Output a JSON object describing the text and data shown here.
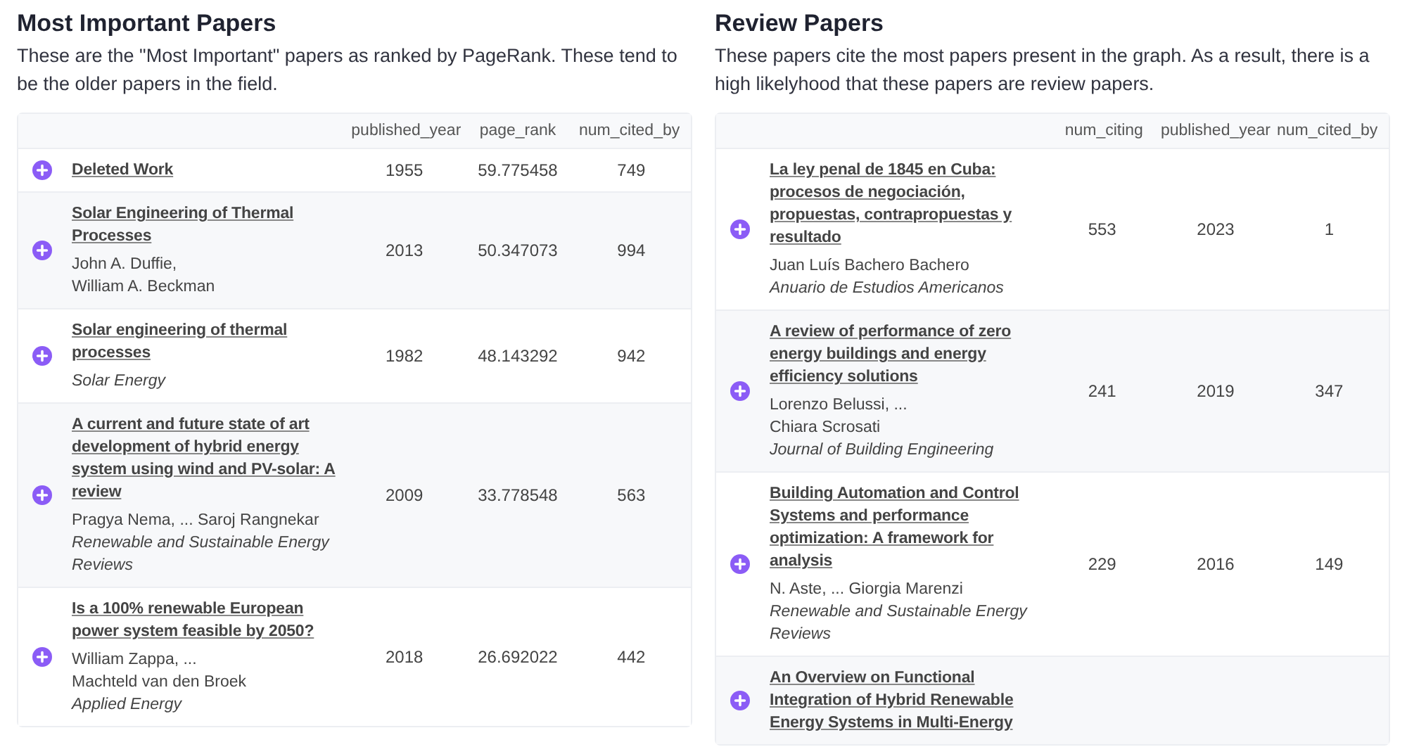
{
  "panels": [
    {
      "title": "Most Important Papers",
      "description": "These are the \"Most Important\" papers as ranked by PageRank. These tend to be the older papers in the field.",
      "columns": [
        "published_year",
        "page_rank",
        "num_cited_by"
      ],
      "rows": [
        {
          "title": "Deleted Work",
          "authors": [],
          "journal": "",
          "values": [
            "1955",
            "59.775458",
            "749"
          ]
        },
        {
          "title": "Solar Engineering of Thermal Processes",
          "authors": [
            "John A. Duffie,",
            "William A. Beckman"
          ],
          "journal": "",
          "values": [
            "2013",
            "50.347073",
            "994"
          ]
        },
        {
          "title": "Solar engineering of thermal processes",
          "authors": [],
          "journal": "Solar Energy",
          "values": [
            "1982",
            "48.143292",
            "942"
          ]
        },
        {
          "title": "A current and future state of art development of hybrid energy system using wind and PV-solar: A review",
          "authors": [
            "Pragya Nema, ... Saroj Rangnekar"
          ],
          "journal": "Renewable and Sustainable Energy Reviews",
          "values": [
            "2009",
            "33.778548",
            "563"
          ]
        },
        {
          "title": "Is a 100% renewable European power system feasible by 2050?",
          "authors": [
            "William Zappa, ...",
            "Machteld van den Broek"
          ],
          "journal": "Applied Energy",
          "values": [
            "2018",
            "26.692022",
            "442"
          ]
        }
      ]
    },
    {
      "title": "Review Papers",
      "description": "These papers cite the most papers present in the graph. As a result, there is a high likelyhood that these papers are review papers.",
      "columns": [
        "num_citing",
        "published_year",
        "num_cited_by"
      ],
      "rows": [
        {
          "title": "La ley penal de 1845 en Cuba: procesos de negociación, propuestas, contrapropuestas y resultado",
          "authors": [
            "Juan Luís Bachero Bachero"
          ],
          "journal": "Anuario de Estudios Americanos",
          "values": [
            "553",
            "2023",
            "1"
          ]
        },
        {
          "title": "A review of performance of zero energy buildings and energy efficiency solutions",
          "authors": [
            "Lorenzo Belussi, ...",
            "Chiara Scrosati"
          ],
          "journal": "Journal of Building Engineering",
          "values": [
            "241",
            "2019",
            "347"
          ]
        },
        {
          "title": "Building Automation and Control Systems and performance optimization: A framework for analysis",
          "authors": [
            "N. Aste, ... Giorgia Marenzi"
          ],
          "journal": "Renewable and Sustainable Energy Reviews",
          "values": [
            "229",
            "2016",
            "149"
          ]
        },
        {
          "title": "An Overview on Functional Integration of Hybrid Renewable Energy Systems in Multi-Energy",
          "authors": [],
          "journal": "",
          "values": []
        }
      ]
    }
  ]
}
